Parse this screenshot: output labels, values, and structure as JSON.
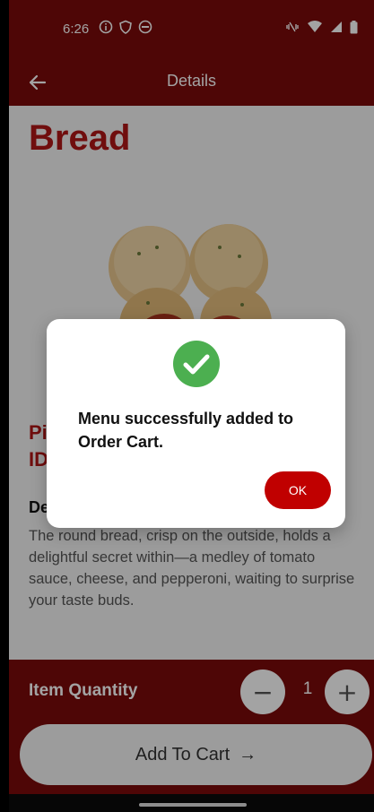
{
  "status_bar": {
    "time": "6:26",
    "left_icons": [
      "info-icon",
      "shield-icon",
      "face-icon"
    ],
    "right_icons": [
      "vibrate-off-icon",
      "wifi-icon",
      "signal-icon",
      "battery-icon"
    ]
  },
  "app_bar": {
    "title": "Details",
    "back_icon": "arrow-left-icon"
  },
  "product": {
    "category_title": "Bread",
    "image_alt": "pizza bread rolls",
    "name_line1_partial": "Pi",
    "name_line2_partial": "ID",
    "description_heading_partial": "De",
    "description_visible": "The round bread, crisp on the outside, holds a delightful secret within—a medley of tomato sauce, cheese, and pepperoni, waiting to surprise your taste buds."
  },
  "quantity": {
    "label": "Item Quantity",
    "value": "1",
    "minus_symbol": "−",
    "plus_symbol": "+"
  },
  "cart": {
    "add_label": "Add To Cart",
    "arrow": "→"
  },
  "dialog": {
    "message": "Menu successfully added to Order Cart.",
    "ok_label": "OK",
    "icon": "check-circle-icon",
    "icon_color": "#4caf50"
  },
  "colors": {
    "brand": "#7a0a0a",
    "accent": "#b01616",
    "button_red": "#c00000"
  }
}
